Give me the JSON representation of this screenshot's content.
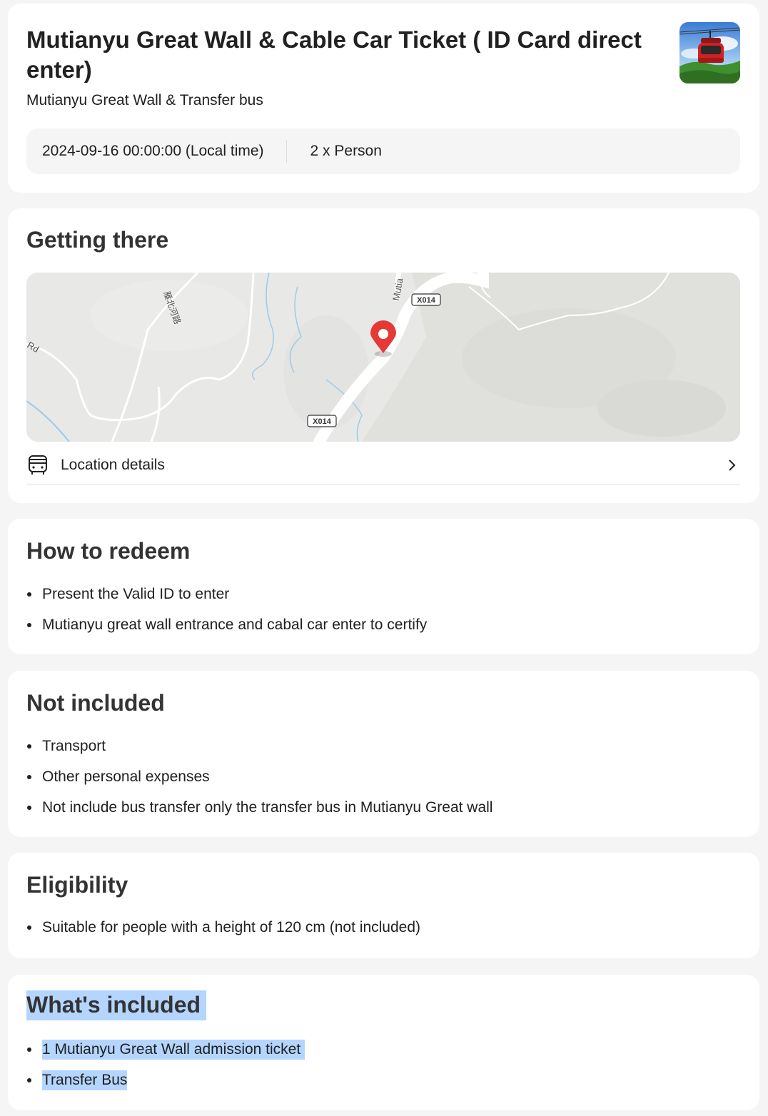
{
  "header": {
    "title": "Mutianyu Great Wall & Cable Car Ticket ( ID Card direct enter)",
    "subtitle": "Mutianyu Great Wall & Transfer bus",
    "date": "2024-09-16 00:00:00 (Local time)",
    "quantity": "2 x Person"
  },
  "getting_there": {
    "title": "Getting there",
    "map": {
      "labels": [
        "Mutia",
        "X014",
        "Rd",
        "X014",
        "雁北河路"
      ]
    },
    "location_details": "Location details"
  },
  "how_to_redeem": {
    "title": "How to redeem",
    "items": [
      "Present the Valid ID to enter",
      "Mutianyu great wall entrance and cabal car enter to certify"
    ]
  },
  "not_included": {
    "title": "Not included",
    "items": [
      "Transport",
      "Other personal expenses",
      "Not include bus transfer only the transfer bus in Mutianyu Great wall"
    ]
  },
  "eligibility": {
    "title": "Eligibility",
    "items": [
      "Suitable for people with a height of 120 cm (not included)"
    ]
  },
  "whats_included": {
    "title": "What's included",
    "items": [
      "1 Mutianyu Great Wall admission ticket",
      "Transfer  Bus"
    ]
  }
}
